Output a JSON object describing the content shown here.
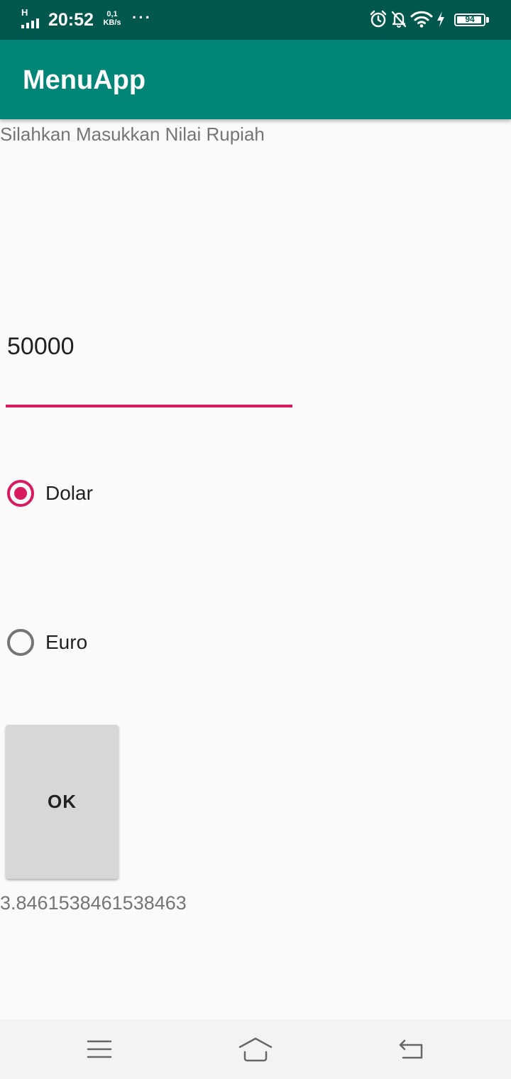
{
  "status_bar": {
    "network_type": "H",
    "time": "20:52",
    "speed_value": "0,1",
    "speed_unit": "KB/s",
    "more": "···",
    "battery_percent": "94",
    "icons": [
      "signal-icon",
      "alarm-icon",
      "notifications-off-icon",
      "wifi-icon",
      "charging-icon",
      "battery-icon"
    ]
  },
  "app_bar": {
    "title": "MenuApp"
  },
  "form": {
    "prompt": "Silahkan Masukkan Nilai Rupiah",
    "amount_value": "50000",
    "options": [
      {
        "label": "Dolar",
        "checked": true
      },
      {
        "label": "Euro",
        "checked": false
      }
    ],
    "ok_label": "OK",
    "result": "3.8461538461538463"
  },
  "colors": {
    "status_bar": "#00574b",
    "app_bar": "#008577",
    "accent": "#d81b60",
    "background": "#fafafa"
  },
  "nav_bar": {
    "icons": [
      "menu-icon",
      "home-icon",
      "back-icon"
    ]
  }
}
